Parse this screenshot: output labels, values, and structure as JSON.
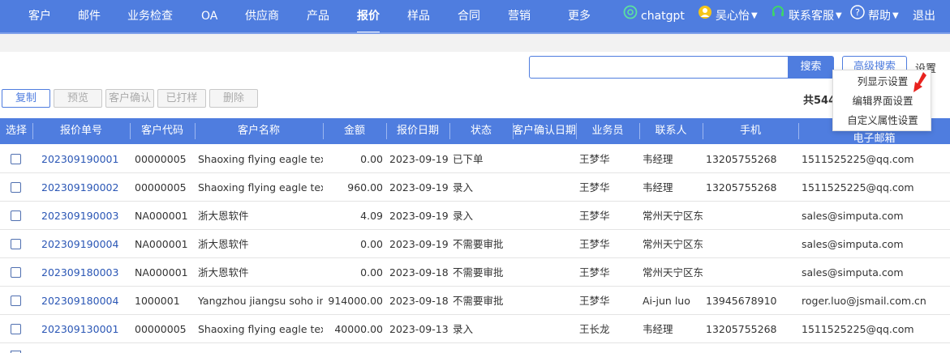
{
  "nav": {
    "items": [
      "客户",
      "邮件",
      "业务检查",
      "OA",
      "供应商",
      "产品",
      "报价",
      "样品",
      "合同",
      "营销",
      "更多"
    ],
    "active": "报价",
    "chatgpt": "chatgpt",
    "user": "吴心怡",
    "support": "联系客服",
    "help": "帮助",
    "logout": "退出"
  },
  "search": {
    "value": "",
    "button": "搜索",
    "advanced": "高级搜索",
    "settings": "设置"
  },
  "settings_menu": [
    "列显示设置",
    "编辑界面设置",
    "自定义属性设置"
  ],
  "toolbar": {
    "copy": "复制",
    "preview": "预览",
    "confirm": "客户确认",
    "printed": "已打样",
    "delete": "删除",
    "total": "共544"
  },
  "table": {
    "headers": [
      "选择",
      "报价单号",
      "客户代码",
      "客户名称",
      "金额",
      "报价日期",
      "状态",
      "客户确认日期",
      "业务员",
      "联系人",
      "手机",
      "电子邮箱"
    ],
    "rows": [
      {
        "no": "202309190001",
        "code": "00000005",
        "name": "Shaoxing flying eagle textil",
        "amount": "0.00",
        "date": "2023-09-19",
        "status": "已下单",
        "confirm": "",
        "sales": "王梦华",
        "contact": "韦经理",
        "mobile": "13205755268",
        "email": "1511525225@qq.com"
      },
      {
        "no": "202309190002",
        "code": "00000005",
        "name": "Shaoxing flying eagle textil",
        "amount": "960.00",
        "date": "2023-09-19",
        "status": "录入",
        "confirm": "",
        "sales": "王梦华",
        "contact": "韦经理",
        "mobile": "13205755268",
        "email": "1511525225@qq.com"
      },
      {
        "no": "202309190003",
        "code": "NA000001",
        "name": "浙大恩软件",
        "amount": "4.09",
        "date": "2023-09-19",
        "status": "录入",
        "confirm": "",
        "sales": "王梦华",
        "contact": "常州天宁区东",
        "mobile": "",
        "email": "sales@simputa.com"
      },
      {
        "no": "202309190004",
        "code": "NA000001",
        "name": "浙大恩软件",
        "amount": "0.00",
        "date": "2023-09-19",
        "status": "不需要审批",
        "confirm": "",
        "sales": "王梦华",
        "contact": "常州天宁区东",
        "mobile": "",
        "email": "sales@simputa.com"
      },
      {
        "no": "202309180003",
        "code": "NA000001",
        "name": "浙大恩软件",
        "amount": "0.00",
        "date": "2023-09-18",
        "status": "不需要审批",
        "confirm": "",
        "sales": "王梦华",
        "contact": "常州天宁区东",
        "mobile": "",
        "email": "sales@simputa.com"
      },
      {
        "no": "202309180004",
        "code": "1000001",
        "name": "Yangzhou jiangsu soho inte",
        "amount": "914000.00",
        "date": "2023-09-18",
        "status": "不需要审批",
        "confirm": "",
        "sales": "王梦华",
        "contact": "Ai-jun luo",
        "mobile": "13945678910",
        "email": "roger.luo@jsmail.com.cn"
      },
      {
        "no": "202309130001",
        "code": "00000005",
        "name": "Shaoxing flying eagle textil",
        "amount": "40000.00",
        "date": "2023-09-13",
        "status": "录入",
        "confirm": "",
        "sales": "王长龙",
        "contact": "韦经理",
        "mobile": "13205755268",
        "email": "1511525225@qq.com"
      }
    ]
  },
  "colors": {
    "primary": "#4f7ddf",
    "link": "#2a56b5",
    "arrow": "#e8231f"
  }
}
